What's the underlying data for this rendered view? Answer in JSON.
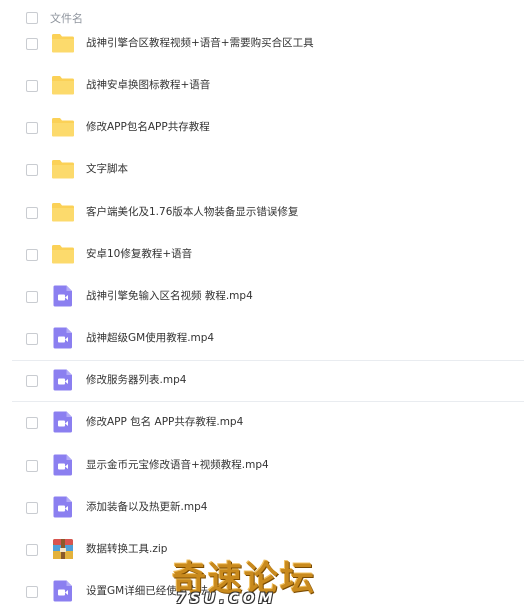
{
  "header": {
    "label": "文件名"
  },
  "files": [
    {
      "name": "战神引擎合区教程视频+语音+需要购买合区工具",
      "type": "folder"
    },
    {
      "name": "战神安卓换图标教程+语音",
      "type": "folder"
    },
    {
      "name": "修改APP包名APP共存教程",
      "type": "folder"
    },
    {
      "name": "文字脚本",
      "type": "folder"
    },
    {
      "name": "客户端美化及1.76版本人物装备显示错误修复",
      "type": "folder"
    },
    {
      "name": "安卓10修复教程+语音",
      "type": "folder"
    },
    {
      "name": "战神引擎免输入区名视频 教程.mp4",
      "type": "video"
    },
    {
      "name": "战神超级GM使用教程.mp4",
      "type": "video"
    },
    {
      "name": "修改服务器列表.mp4",
      "type": "video",
      "highlighted": true
    },
    {
      "name": "修改APP 包名 APP共存教程.mp4",
      "type": "video"
    },
    {
      "name": "显示金币元宝修改语音+视频教程.mp4",
      "type": "video"
    },
    {
      "name": "添加装备以及热更新.mp4",
      "type": "video"
    },
    {
      "name": "数据转换工具.zip",
      "type": "zip"
    },
    {
      "name": "设置GM详细已经使用方法",
      "type": "video"
    }
  ],
  "icons": {
    "folder": "folder-icon",
    "video": "video-file-icon",
    "zip": "zip-archive-icon"
  },
  "colors": {
    "folder": "#fbd157",
    "video": "#8b7ff0",
    "text": "#333333",
    "header_text": "#8f959e"
  },
  "watermark": {
    "text": "奇速论坛",
    "subtext": "7SU.COM"
  }
}
